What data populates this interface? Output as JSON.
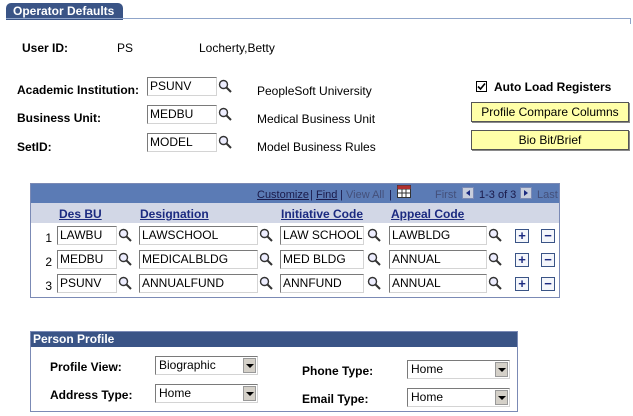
{
  "page": {
    "tab_label": "Operator Defaults"
  },
  "user": {
    "label": "User ID:",
    "id": "PS",
    "name": "Locherty,Betty"
  },
  "fields": [
    {
      "label": "Academic Institution:",
      "value": "PSUNV",
      "description": "PeopleSoft University"
    },
    {
      "label": "Business Unit:",
      "value": "MEDBU",
      "description": "Medical Business Unit"
    },
    {
      "label": "SetID:",
      "value": "MODEL",
      "description": "Model Business Rules"
    }
  ],
  "auto_load": {
    "label": "Auto Load Registers",
    "checked": true
  },
  "buttons": {
    "profile_compare": "Profile Compare Columns",
    "bio_bit": "Bio Bit/Brief"
  },
  "grid": {
    "nav": {
      "customize": "Customize",
      "sep1": "|",
      "find": "Find",
      "sep2": "|",
      "view_all": "View All",
      "sep3": "|",
      "first": "First",
      "range": "1-3 of 3",
      "last": "Last"
    },
    "columns": [
      "Des BU",
      "Designation",
      "Initiative Code",
      "Appeal Code"
    ],
    "rows": [
      {
        "num": "1",
        "des_bu": "LAWBU",
        "designation": "LAWSCHOOL",
        "initiative": "LAW SCHOOL",
        "appeal": "LAWBLDG"
      },
      {
        "num": "2",
        "des_bu": "MEDBU",
        "designation": "MEDICALBLDG",
        "initiative": "MED BLDG",
        "appeal": "ANNUAL"
      },
      {
        "num": "3",
        "des_bu": "PSUNV",
        "designation": "ANNUALFUND",
        "initiative": "ANNFUND",
        "appeal": "ANNUAL"
      }
    ],
    "add_symbol": "+",
    "remove_symbol": "−"
  },
  "person_profile": {
    "title": "Person Profile",
    "profile_view": {
      "label": "Profile View:",
      "value": "Biographic"
    },
    "address_type": {
      "label": "Address Type:",
      "value": "Home"
    },
    "phone_type": {
      "label": "Phone Type:",
      "value": "Home"
    },
    "email_type": {
      "label": "Email Type:",
      "value": "Home"
    }
  },
  "icons": {
    "lookup": "magnifier-icon",
    "add": "plus-icon",
    "remove": "minus-icon",
    "grid_download": "grid-download-icon",
    "nav_first": "arrow-left-icon",
    "nav_last": "arrow-right-icon"
  },
  "colors": {
    "accent": "#3a5486",
    "grid_header": "#5b7bb5",
    "button_bg": "#ffffa8",
    "col_header_bg": "#d2d7e6"
  }
}
